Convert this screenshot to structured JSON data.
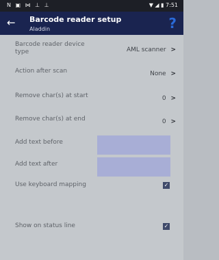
{
  "status_bar": {
    "left_icons": "N ▣ ⋈ ⊥ ⊥",
    "right_icons": "▼ ◢ ▮",
    "time": "7:51"
  },
  "app_bar": {
    "title": "Barcode reader setup",
    "subtitle": "Aladdin",
    "help": "?"
  },
  "settings": {
    "device_type": {
      "label": "Barcode reader device type",
      "value": "AML scanner",
      "chev": ">"
    },
    "action_after_scan": {
      "label": "Action after scan",
      "value": "None",
      "chev": ">"
    },
    "remove_start": {
      "label": "Remove char(s) at start",
      "value": "0",
      "chev": ">"
    },
    "remove_end": {
      "label": "Remove char(s) at end",
      "value": "0",
      "chev": ">"
    },
    "add_before": {
      "label": "Add text before",
      "value": ""
    },
    "add_after": {
      "label": "Add text after",
      "value": ""
    },
    "keyboard_mapping": {
      "label": "Use keyboard mapping",
      "checked": "✓"
    },
    "status_line": {
      "label": "Show on status line",
      "checked": "✓"
    }
  }
}
